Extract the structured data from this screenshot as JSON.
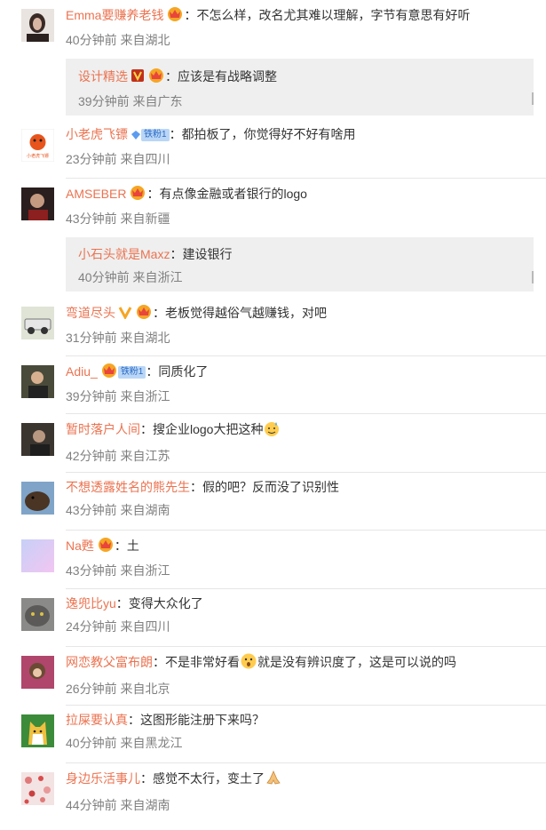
{
  "comments": [
    {
      "user": "Emma要赚养老钱",
      "sep": "：",
      "text": "不怎么样，改名尤其难以理解，字节有意思有好听",
      "time": "40分钟前",
      "loc": "来自湖北",
      "reply": {
        "user": "设计精选",
        "sep": "：",
        "text": "应该是有战略调整",
        "time": "39分钟前",
        "loc": "来自广东"
      }
    },
    {
      "user": "小老虎飞镖",
      "fans": "铁粉1",
      "sep": "：",
      "text": "都拍板了，你觉得好不好有啥用",
      "time": "23分钟前",
      "loc": "来自四川"
    },
    {
      "user": "AMSEBER",
      "sep": "：",
      "text": "有点像金融或者银行的logo",
      "time": "43分钟前",
      "loc": "来自新疆",
      "reply": {
        "user": "小石头就是Maxz",
        "sep": "：",
        "text": "建设银行",
        "time": "40分钟前",
        "loc": "来自浙江"
      }
    },
    {
      "user": "弯道尽头",
      "sep": "：",
      "text": "老板觉得越俗气越赚钱，对吧",
      "time": "31分钟前",
      "loc": "来自湖北"
    },
    {
      "user": "Adiu_",
      "fans": "铁粉1",
      "sep": "：",
      "text": "同质化了",
      "time": "39分钟前",
      "loc": "来自浙江"
    },
    {
      "user": "暂时落户人间",
      "sep": "：",
      "text": "搜企业logo大把这种",
      "time": "42分钟前",
      "loc": "来自江苏"
    },
    {
      "user": "不想透露姓名的熊先生",
      "sep": "：",
      "text": "假的吧？反而没了识别性",
      "time": "43分钟前",
      "loc": "来自湖南"
    },
    {
      "user": "Na甦",
      "sep": "：",
      "text": "土",
      "time": "43分钟前",
      "loc": "来自浙江"
    },
    {
      "user": "逸兜比yu",
      "sep": "：",
      "text": "变得大众化了",
      "time": "24分钟前",
      "loc": "来自四川"
    },
    {
      "user": "网恋教父富布朗",
      "sep": "：",
      "text": "不是非常好看",
      "text2": "就是没有辨识度了，这是可以说的吗",
      "time": "26分钟前",
      "loc": "来自北京"
    },
    {
      "user": "拉屎要认真",
      "sep": "：",
      "text": "这图形能注册下来吗？",
      "time": "40分钟前",
      "loc": "来自黑龙江"
    },
    {
      "user": "身边乐活事儿",
      "sep": "：",
      "text": "感觉不太行，变土了",
      "time": "44分钟前",
      "loc": "来自湖南"
    }
  ],
  "colors": {
    "username": "#eb7350",
    "text": "#333333",
    "meta": "#808080",
    "reply_bg": "#efefef"
  },
  "avatar_texts": {
    "tiger": "小老虎飞镖"
  }
}
